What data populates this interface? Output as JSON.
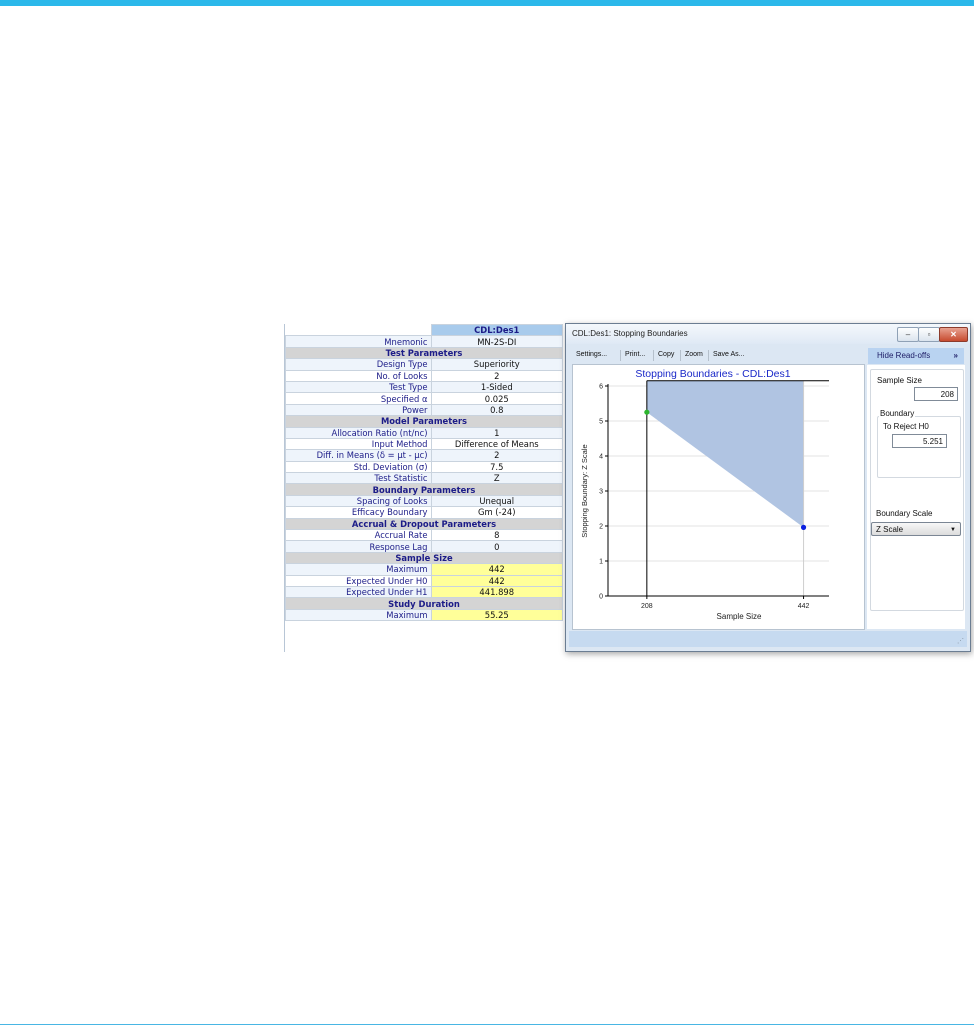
{
  "design_table": {
    "column_header": "CDL:Des1",
    "rows": [
      {
        "kind": "row",
        "label": "Mnemonic",
        "value": "MN-2S-DI"
      },
      {
        "kind": "section",
        "label": "Test Parameters"
      },
      {
        "kind": "row",
        "label": "Design Type",
        "value": "Superiority"
      },
      {
        "kind": "row",
        "label": "No. of Looks",
        "value": "2"
      },
      {
        "kind": "row",
        "label": "Test Type",
        "value": "1-Sided"
      },
      {
        "kind": "row",
        "label": "Specified α",
        "value": "0.025"
      },
      {
        "kind": "row",
        "label": "Power",
        "value": "0.8"
      },
      {
        "kind": "section",
        "label": "Model Parameters"
      },
      {
        "kind": "row",
        "label": "Allocation Ratio (nt/nc)",
        "value": "1"
      },
      {
        "kind": "row",
        "label": "Input Method",
        "value": "Difference of Means"
      },
      {
        "kind": "row",
        "label": "Diff. in Means (δ = μt - μc)",
        "value": "2"
      },
      {
        "kind": "row",
        "label": "Std. Deviation (σ)",
        "value": "7.5"
      },
      {
        "kind": "row",
        "label": "Test Statistic",
        "value": "Z"
      },
      {
        "kind": "section",
        "label": "Boundary Parameters"
      },
      {
        "kind": "row",
        "label": "Spacing of Looks",
        "value": "Unequal"
      },
      {
        "kind": "row",
        "label": "Efficacy Boundary",
        "value": "Gm (-24)"
      },
      {
        "kind": "section",
        "label": "Accrual & Dropout Parameters"
      },
      {
        "kind": "row",
        "label": "Accrual Rate",
        "value": "8"
      },
      {
        "kind": "row",
        "label": "Response Lag",
        "value": "0"
      },
      {
        "kind": "section",
        "label": "Sample Size"
      },
      {
        "kind": "row",
        "label": "Maximum",
        "value": "442",
        "highlight": true
      },
      {
        "kind": "row",
        "label": "Expected Under H0",
        "value": "442",
        "highlight": true
      },
      {
        "kind": "row",
        "label": "Expected Under H1",
        "value": "441.898",
        "highlight": true
      },
      {
        "kind": "section",
        "label": "Study Duration"
      },
      {
        "kind": "row",
        "label": "Maximum",
        "value": "55.25",
        "highlight": true
      }
    ]
  },
  "window": {
    "title": "CDL:Des1: Stopping Boundaries",
    "controls": {
      "minimize": "–",
      "maximize": "▫",
      "close": "✕"
    },
    "toolbar": [
      "Settings...",
      "Print...",
      "Copy",
      "Zoom",
      "Save As..."
    ]
  },
  "readoffs": {
    "toggle_label": "Hide Read-offs",
    "toggle_icon": "»",
    "sample_size_label": "Sample Size",
    "sample_size_value": "208",
    "boundary_group_label": "Boundary",
    "to_reject_label": "To Reject H0",
    "to_reject_value": "5.251",
    "boundary_scale_label": "Boundary Scale",
    "boundary_scale_selected": "Z Scale"
  },
  "chart_data": {
    "type": "scatter",
    "title": "Stopping Boundaries - CDL:Des1",
    "xlabel": "Sample Size",
    "ylabel": "Stopping Boundary: Z Scale",
    "x_ticks": [
      208,
      442
    ],
    "y_ticks": [
      0,
      1,
      2,
      3,
      4,
      5,
      6
    ],
    "ylim": [
      0,
      6
    ],
    "points": [
      {
        "x": 208,
        "y": 5.251,
        "color": "#2db52d"
      },
      {
        "x": 442,
        "y": 1.96,
        "color": "#0a1fe0"
      }
    ],
    "rejection_region_color": "#b0c4e2",
    "grid": true
  }
}
